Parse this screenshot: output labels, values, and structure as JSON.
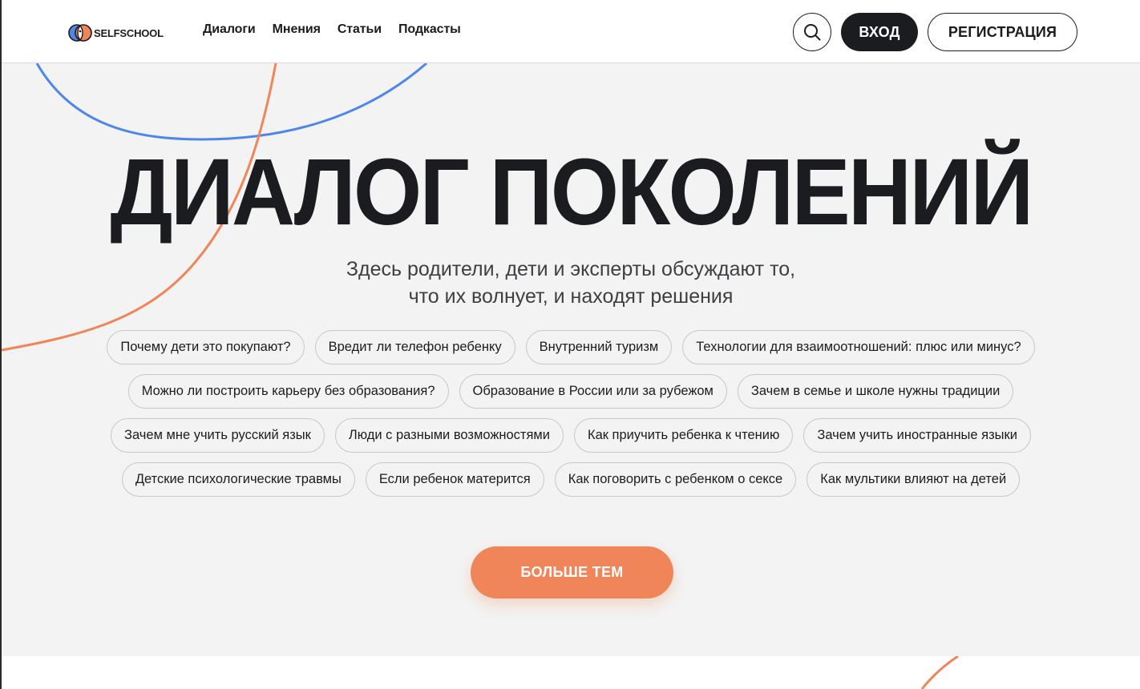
{
  "header": {
    "logo_text": "SELFSCHOOL",
    "nav": [
      {
        "label": "Диалоги"
      },
      {
        "label": "Мнения"
      },
      {
        "label": "Статьи"
      },
      {
        "label": "Подкасты"
      }
    ],
    "search_icon": "search-icon",
    "login_label": "ВХОД",
    "register_label": "РЕГИСТРАЦИЯ"
  },
  "hero": {
    "title": "ДИАЛОГ ПОКОЛЕНИЙ",
    "subtitle_line1": "Здесь родители, дети и эксперты обсуждают то,",
    "subtitle_line2": "что их волнует, и находят решения",
    "topics": [
      [
        "Почему дети это покупают?",
        "Вредит ли телефон ребенку",
        "Внутренний туризм",
        "Технологии для взаимоотношений: плюс или минус?"
      ],
      [
        "Можно ли построить карьеру без образования?",
        "Образование в России или за рубежом",
        "Зачем в семье и школе нужны традиции"
      ],
      [
        "Зачем мне учить русский язык",
        "Люди с разными возможностями",
        "Как приучить ребенка к чтению",
        "Зачем учить иностранные языки"
      ],
      [
        "Детские психологические травмы",
        "Если ребенок матерится",
        "Как поговорить с ребенком о сексе",
        "Как мультики влияют на детей"
      ]
    ],
    "more_button": "БОЛЬШЕ ТЕМ"
  },
  "colors": {
    "accent_orange": "#ef8558",
    "accent_blue": "#4f86e8",
    "dark": "#1b1c1f",
    "hero_bg": "#f3f3f3"
  }
}
